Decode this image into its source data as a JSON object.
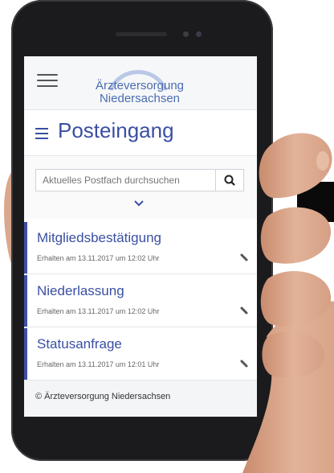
{
  "header": {
    "logo_line1": "Ärzteversorgung",
    "logo_line2": "Niedersachsen"
  },
  "page": {
    "title": "Posteingang"
  },
  "search": {
    "placeholder": "Aktuelles Postfach durchsuchen"
  },
  "messages": [
    {
      "subject": "Mitgliedsbestätigung",
      "date": "Erhalten am 13.11.2017 um 12:02 Uhr"
    },
    {
      "subject": "Niederlassung",
      "date": "Erhalten am 13.11.2017 um 12:02 Uhr"
    },
    {
      "subject": "Statusanfrage",
      "date": "Erhalten am 13.11.2017 um 12:01 Uhr"
    }
  ],
  "footer": {
    "text": "© Ärzteversorgung Niedersachsen"
  },
  "colors": {
    "accent": "#3a4fa3",
    "logo": "#4a6db0",
    "phone_body": "#1b1b1d"
  }
}
